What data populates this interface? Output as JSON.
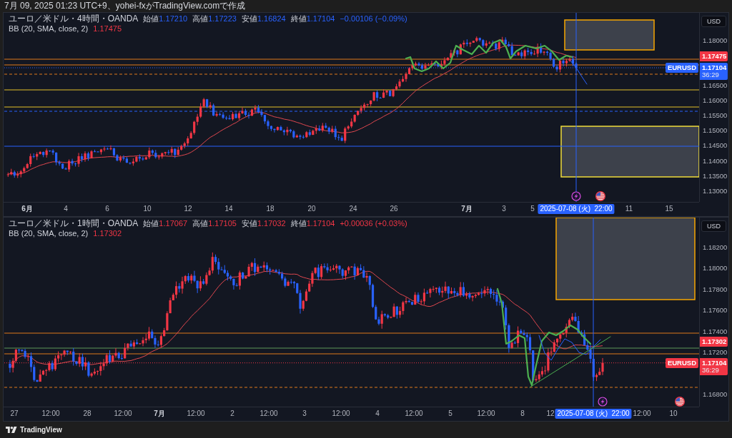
{
  "caption": "7月 09, 2025 01:23 UTC+9、yohei-fxがTradingView.comで作成",
  "panes": [
    {
      "title": "ユーロ／米ドル・4時間・OANDA",
      "color": "#2962ff",
      "ohlc": [
        {
          "label": "始値",
          "value": "1.17210"
        },
        {
          "label": "高値",
          "value": "1.17223"
        },
        {
          "label": "安値",
          "value": "1.16824"
        },
        {
          "label": "終値",
          "value": "1.17104"
        }
      ],
      "change": "−0.00106 (−0.09%)",
      "indicator": {
        "label": "BB (20, SMA, close, 2)",
        "value": "1.17475"
      },
      "currency": "USD",
      "price_ticks": [
        "1.18000",
        "1.16500",
        "1.16000",
        "1.15500",
        "1.15000",
        "1.14500",
        "1.14000",
        "1.13500",
        "1.13000"
      ],
      "indicator_price": "1.17475",
      "last_price": {
        "symbol": "EURUSD",
        "value": "1.17104",
        "countdown": "36:29"
      },
      "time_ticks": [
        {
          "label": "6月",
          "bold": true
        },
        {
          "label": "4",
          "bold": false
        },
        {
          "label": "6",
          "bold": false
        },
        {
          "label": "10",
          "bold": false
        },
        {
          "label": "12",
          "bold": false
        },
        {
          "label": "14",
          "bold": false
        },
        {
          "label": "18",
          "bold": false
        },
        {
          "label": "20",
          "bold": false
        },
        {
          "label": "24",
          "bold": false
        },
        {
          "label": "26",
          "bold": false
        },
        {
          "label": "7月",
          "bold": true
        },
        {
          "label": "3",
          "bold": false
        },
        {
          "label": "5",
          "bold": false
        },
        {
          "label": "11",
          "bold": false
        },
        {
          "label": "15",
          "bold": false
        }
      ],
      "crosshair_time": "2025-07-08 (火)  22:00"
    },
    {
      "title": "ユーロ／米ドル・1時間・OANDA",
      "color": "#f23645",
      "ohlc": [
        {
          "label": "始値",
          "value": "1.17067"
        },
        {
          "label": "高値",
          "value": "1.17105"
        },
        {
          "label": "安値",
          "value": "1.17032"
        },
        {
          "label": "終値",
          "value": "1.17104"
        }
      ],
      "change": "+0.00036 (+0.03%)",
      "indicator": {
        "label": "BB (20, SMA, close, 2)",
        "value": "1.17302"
      },
      "currency": "USD",
      "price_ticks": [
        "1.18200",
        "1.18000",
        "1.17800",
        "1.17600",
        "1.17400",
        "1.17200",
        "1.16800"
      ],
      "indicator_price": "1.17302",
      "last_price": {
        "symbol": "EURUSD",
        "value": "1.17104",
        "countdown": "36:29"
      },
      "time_ticks": [
        {
          "label": "27",
          "bold": false
        },
        {
          "label": "12:00",
          "bold": false
        },
        {
          "label": "28",
          "bold": false
        },
        {
          "label": "12:00",
          "bold": false
        },
        {
          "label": "7月",
          "bold": true
        },
        {
          "label": "12:00",
          "bold": false
        },
        {
          "label": "2",
          "bold": false
        },
        {
          "label": "12:00",
          "bold": false
        },
        {
          "label": "3",
          "bold": false
        },
        {
          "label": "12:00",
          "bold": false
        },
        {
          "label": "4",
          "bold": false
        },
        {
          "label": "12:00",
          "bold": false
        },
        {
          "label": "5",
          "bold": false
        },
        {
          "label": "12:00",
          "bold": false
        },
        {
          "label": "8",
          "bold": false
        },
        {
          "label": "12",
          "bold": false
        },
        {
          "label": "12:00",
          "bold": false
        },
        {
          "label": "10",
          "bold": false
        }
      ],
      "crosshair_time": "2025-07-08 (火)  22:00"
    }
  ],
  "footer": {
    "brand": "TradingView"
  }
}
